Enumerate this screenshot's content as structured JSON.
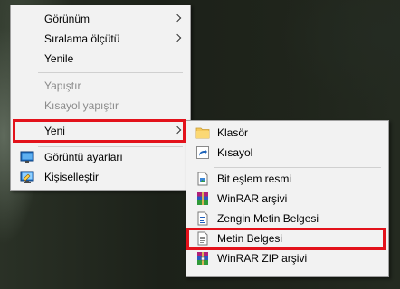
{
  "context_menu": {
    "items": [
      {
        "label": "Görünüm"
      },
      {
        "label": "Sıralama ölçütü"
      },
      {
        "label": "Yenile"
      },
      {
        "label": "Yapıştır"
      },
      {
        "label": "Kısayol yapıştır"
      },
      {
        "label": "Yeni"
      },
      {
        "label": "Görüntü ayarları"
      },
      {
        "label": "Kişiselleştir"
      }
    ]
  },
  "new_submenu": {
    "items": [
      {
        "label": "Klasör"
      },
      {
        "label": "Kısayol"
      },
      {
        "label": "Bit eşlem resmi"
      },
      {
        "label": "WinRAR arşivi"
      },
      {
        "label": "Zengin Metin Belgesi"
      },
      {
        "label": "Metin Belgesi"
      },
      {
        "label": "WinRAR ZIP arşivi"
      }
    ]
  },
  "colors": {
    "menu_background": "#f2f2f2",
    "highlight_border": "#e3121b",
    "disabled_text": "#8b8b8b"
  }
}
